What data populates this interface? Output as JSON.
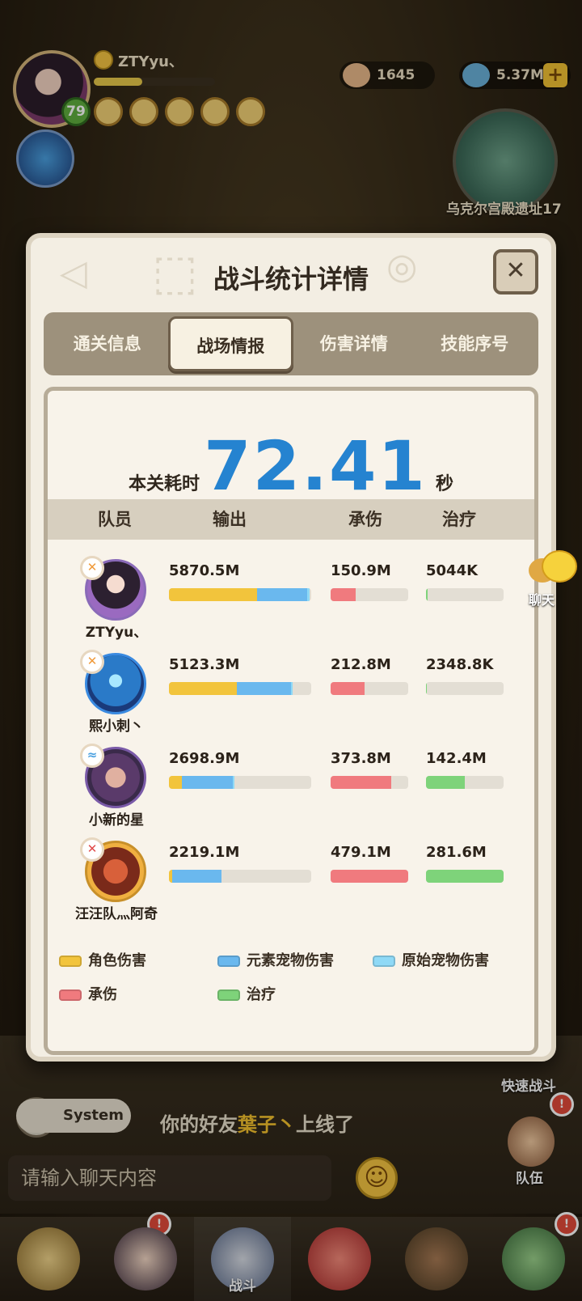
{
  "hud": {
    "player_name": "ZTYyu、",
    "level": "79",
    "gold": "1645",
    "gems": "5.37M",
    "plus": "+",
    "map_name": "乌克尔宫殿遗址17"
  },
  "modal": {
    "title": "战斗统计详情",
    "close": "✕",
    "tabs": [
      "通关信息",
      "战场情报",
      "伤害详情",
      "技能序号"
    ],
    "active_tab": 1,
    "time_label": "本关耗时",
    "time_value": "72.41",
    "time_unit": "秒",
    "columns": [
      "队员",
      "输出",
      "承伤",
      "治疗"
    ],
    "members": [
      {
        "name": "ZTYyu、",
        "element": "fire",
        "output": "5870.5M",
        "tank": "150.9M",
        "heal": "5044K",
        "output_split": {
          "role": 0.62,
          "element_pet": 0.35,
          "origin_pet": 0.02
        },
        "tank_ratio": 0.32,
        "heal_ratio": 0.02
      },
      {
        "name": "熙小刺丶",
        "element": "fire",
        "output": "5123.3M",
        "tank": "212.8M",
        "heal": "2348.8K",
        "output_split": {
          "role": 0.48,
          "element_pet": 0.38,
          "origin_pet": 0.01
        },
        "tank_ratio": 0.44,
        "heal_ratio": 0.01
      },
      {
        "name": "小新的星",
        "element": "water",
        "output": "2698.9M",
        "tank": "373.8M",
        "heal": "142.4M",
        "output_split": {
          "role": 0.09,
          "element_pet": 0.36,
          "origin_pet": 0.01
        },
        "tank_ratio": 0.78,
        "heal_ratio": 0.5
      },
      {
        "name": "汪汪队灬阿奇",
        "element": "earth",
        "output": "2219.1M",
        "tank": "479.1M",
        "heal": "281.6M",
        "output_split": {
          "role": 0.02,
          "element_pet": 0.35,
          "origin_pet": 0.0
        },
        "tank_ratio": 1.0,
        "heal_ratio": 1.0
      }
    ],
    "legend": [
      {
        "label": "角色伤害",
        "color": "#f2c43c"
      },
      {
        "label": "元素宠物伤害",
        "color": "#6ab8ee"
      },
      {
        "label": "原始宠物伤害",
        "color": "#8fd9f6"
      },
      {
        "label": "承伤",
        "color": "#f07a7e"
      },
      {
        "label": "治疗",
        "color": "#7ed37a"
      }
    ]
  },
  "chat": {
    "bubble_label": "聊天",
    "system_label": "System",
    "message_prefix": "你的好友",
    "message_friend": "葉子丶",
    "message_suffix": "上线了",
    "input_placeholder": "请输入聊天内容",
    "emoji": "☺"
  },
  "side": {
    "quick_battle": "快速战斗",
    "team": "队伍"
  },
  "nav": {
    "battle_label": "战斗",
    "items": [
      "hero",
      "avatar",
      "battle",
      "pet",
      "bear",
      "shop"
    ]
  },
  "colors": {
    "accent_blue": "#2583d0",
    "role_dmg": "#f2c43c",
    "element_pet": "#6ab8ee",
    "origin_pet": "#8fd9f6",
    "tank": "#f07a7e",
    "heal": "#7ed37a"
  }
}
